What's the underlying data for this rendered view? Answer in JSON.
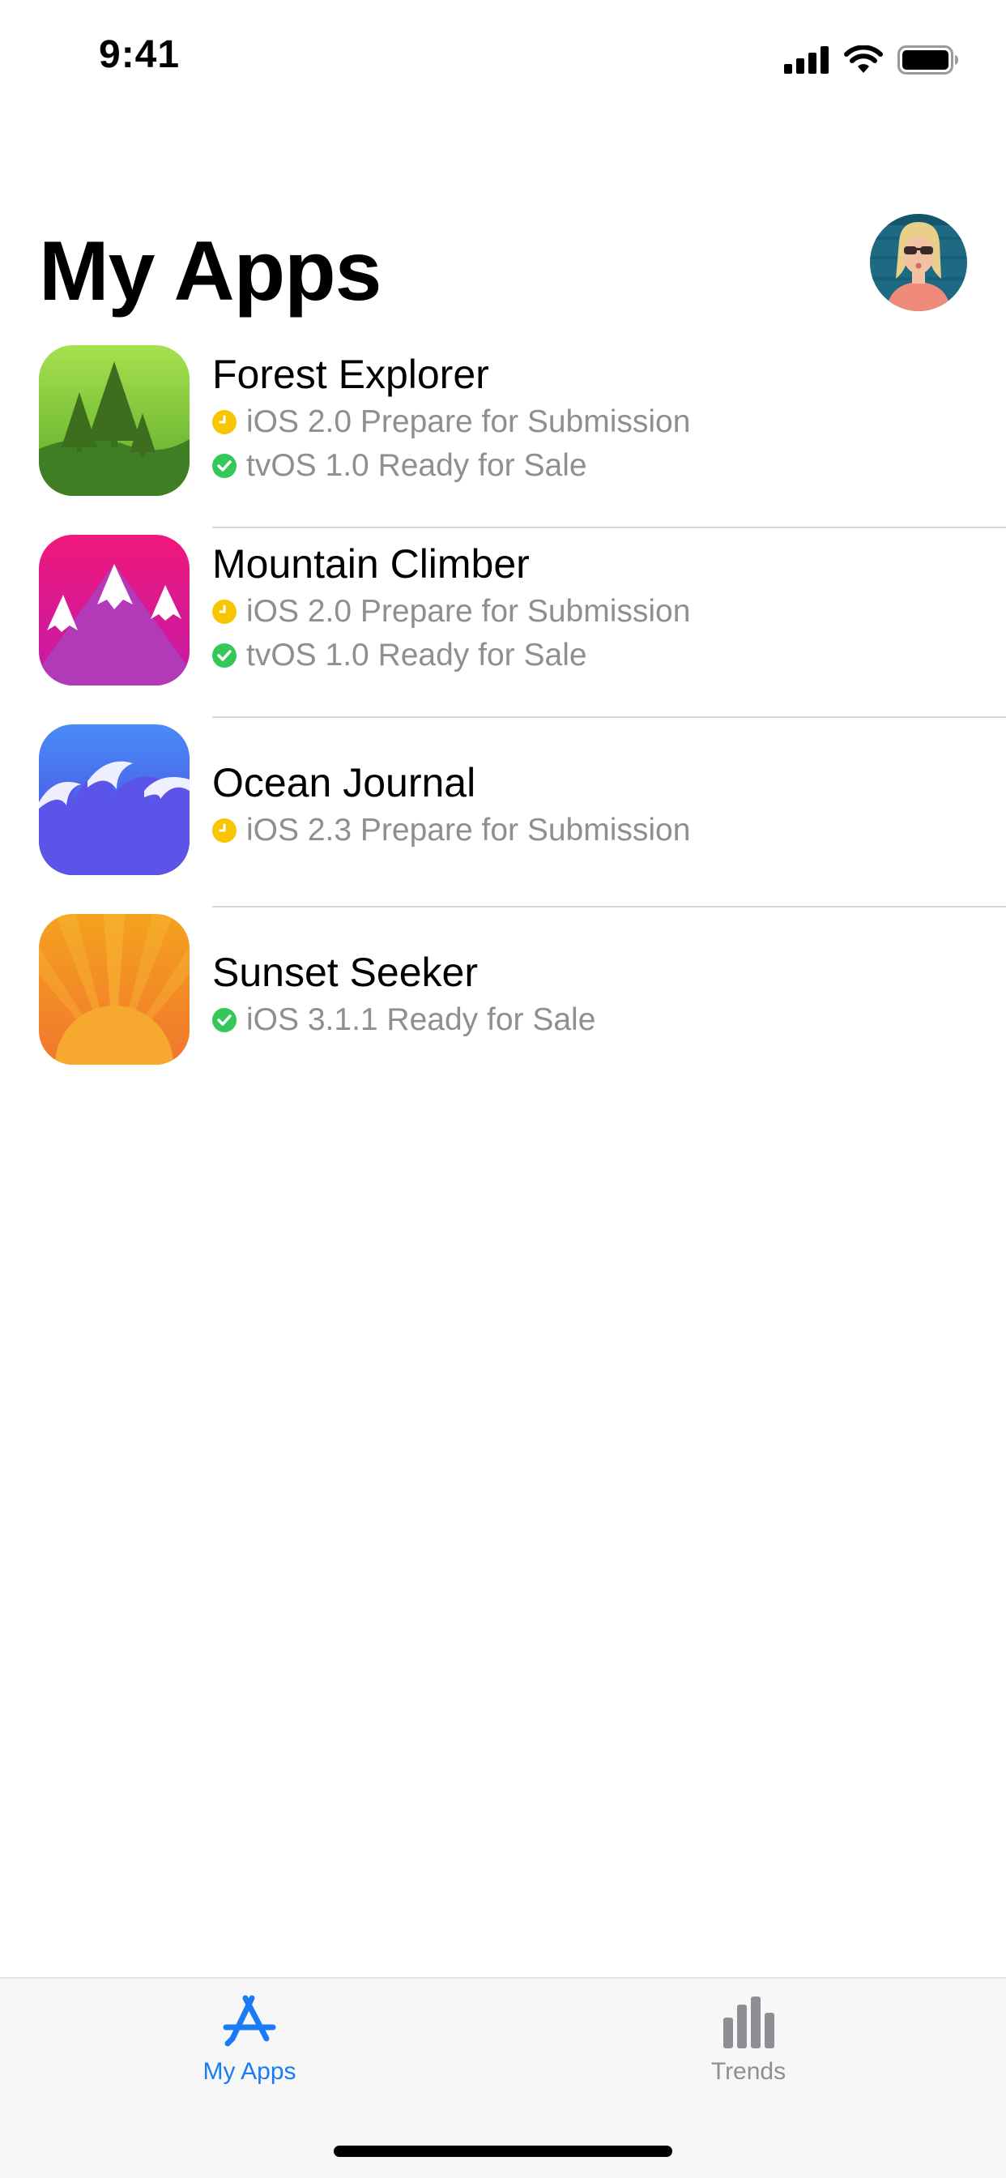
{
  "status_bar": {
    "time": "9:41"
  },
  "header": {
    "title": "My Apps"
  },
  "apps": [
    {
      "name": "Forest Explorer",
      "icon": "forest-icon",
      "statuses": [
        {
          "text": "iOS 2.0 Prepare for Submission",
          "state": "pending"
        },
        {
          "text": "tvOS 1.0 Ready for Sale",
          "state": "ready"
        }
      ]
    },
    {
      "name": "Mountain Climber",
      "icon": "mountain-icon",
      "statuses": [
        {
          "text": "iOS 2.0 Prepare for Submission",
          "state": "pending"
        },
        {
          "text": "tvOS 1.0 Ready for Sale",
          "state": "ready"
        }
      ]
    },
    {
      "name": "Ocean Journal",
      "icon": "ocean-icon",
      "statuses": [
        {
          "text": "iOS 2.3 Prepare for Submission",
          "state": "pending"
        }
      ]
    },
    {
      "name": "Sunset Seeker",
      "icon": "sunset-icon",
      "statuses": [
        {
          "text": "iOS 3.1.1 Ready for Sale",
          "state": "ready"
        }
      ]
    }
  ],
  "tab_bar": {
    "tabs": [
      {
        "label": "My Apps",
        "icon": "app-store-icon",
        "active": true
      },
      {
        "label": "Trends",
        "icon": "bar-chart-icon",
        "active": false
      }
    ]
  },
  "colors": {
    "accent": "#1a7cf5",
    "pending": "#f7c600",
    "ready": "#34c759",
    "secondary_text": "#8e8e93"
  }
}
